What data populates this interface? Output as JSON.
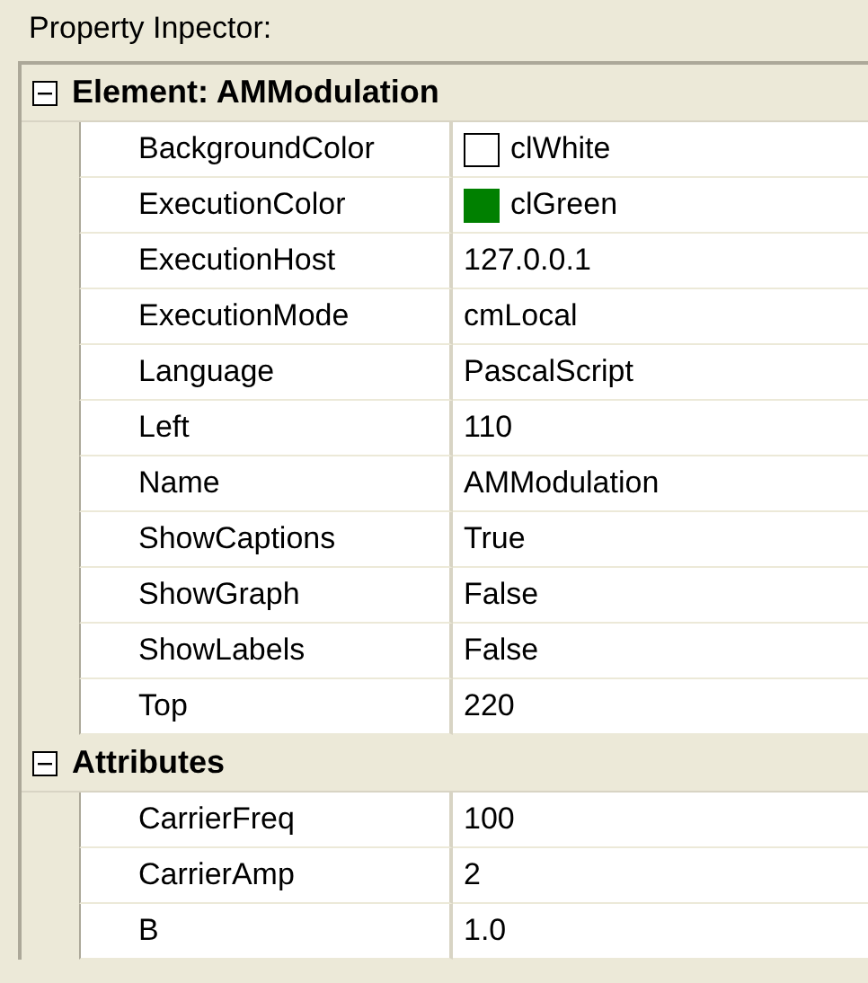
{
  "panel_title": "Property Inpector:",
  "categories": [
    {
      "title": "Element: AMModulation",
      "expanded": true,
      "properties": [
        {
          "name": "BackgroundColor",
          "kind": "color",
          "color": "#ffffff",
          "value": "clWhite"
        },
        {
          "name": "ExecutionColor",
          "kind": "color",
          "color": "#008000",
          "value": "clGreen"
        },
        {
          "name": "ExecutionHost",
          "kind": "text",
          "value": "127.0.0.1"
        },
        {
          "name": "ExecutionMode",
          "kind": "text",
          "value": "cmLocal"
        },
        {
          "name": "Language",
          "kind": "text",
          "value": "PascalScript"
        },
        {
          "name": "Left",
          "kind": "text",
          "value": "110"
        },
        {
          "name": "Name",
          "kind": "text",
          "value": "AMModulation"
        },
        {
          "name": "ShowCaptions",
          "kind": "text",
          "value": "True"
        },
        {
          "name": "ShowGraph",
          "kind": "text",
          "value": "False"
        },
        {
          "name": "ShowLabels",
          "kind": "text",
          "value": "False"
        },
        {
          "name": "Top",
          "kind": "text",
          "value": "220"
        }
      ]
    },
    {
      "title": "Attributes",
      "expanded": true,
      "properties": [
        {
          "name": "CarrierFreq",
          "kind": "text",
          "value": "100"
        },
        {
          "name": "CarrierAmp",
          "kind": "text",
          "value": "2"
        },
        {
          "name": "B",
          "kind": "text",
          "value": "1.0"
        }
      ]
    }
  ]
}
